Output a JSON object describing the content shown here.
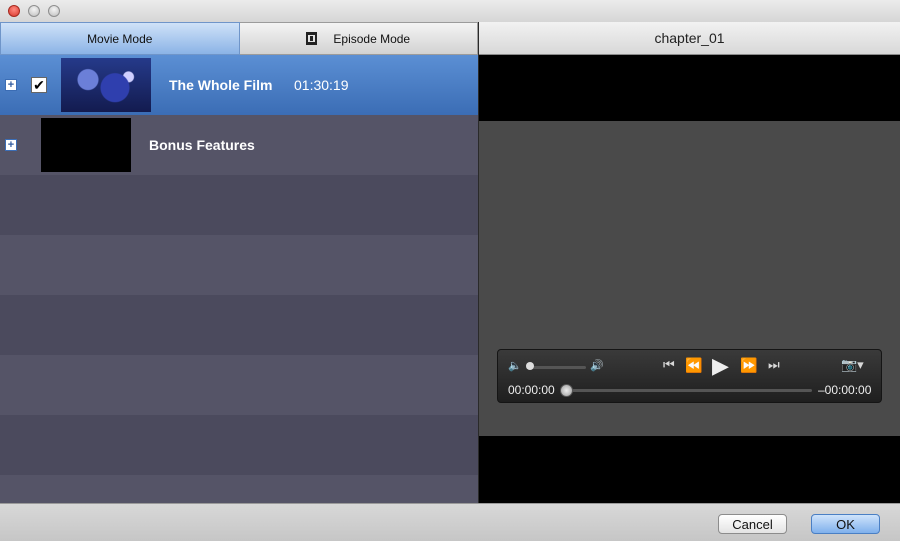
{
  "window": {
    "title": ""
  },
  "tabs": [
    {
      "label": "Movie Mode",
      "active": true
    },
    {
      "label": "Episode Mode",
      "active": false,
      "icon": "film-icon"
    }
  ],
  "items": [
    {
      "title": "The Whole Film",
      "duration": "01:30:19",
      "checked": true,
      "selected": true
    },
    {
      "title": "Bonus Features",
      "duration": "",
      "checked": false,
      "selected": false
    }
  ],
  "preview": {
    "chapter": "chapter_01",
    "elapsed": "00:00:00",
    "remaining": "–00:00:00",
    "volume_fraction": 0.0,
    "progress_fraction": 0.0
  },
  "footer": {
    "cancel_label": "Cancel",
    "ok_label": "OK"
  },
  "colors": {
    "selection": "#3b6db5",
    "list_bg": "#4a4a5e",
    "ok_button": "#7fb0ec"
  }
}
